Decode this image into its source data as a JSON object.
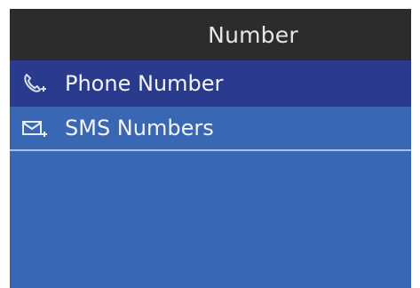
{
  "header": {
    "title": "Number"
  },
  "menu": {
    "items": [
      {
        "label": "Phone Number",
        "icon": "phone-add-icon",
        "selected": true
      },
      {
        "label": "SMS Numbers",
        "icon": "envelope-add-icon",
        "selected": false
      }
    ]
  },
  "colors": {
    "header_bg": "#2c2c2c",
    "selected_bg": "#2a3a8c",
    "list_bg": "#3a67b3",
    "divider": "#a9c2ea"
  }
}
